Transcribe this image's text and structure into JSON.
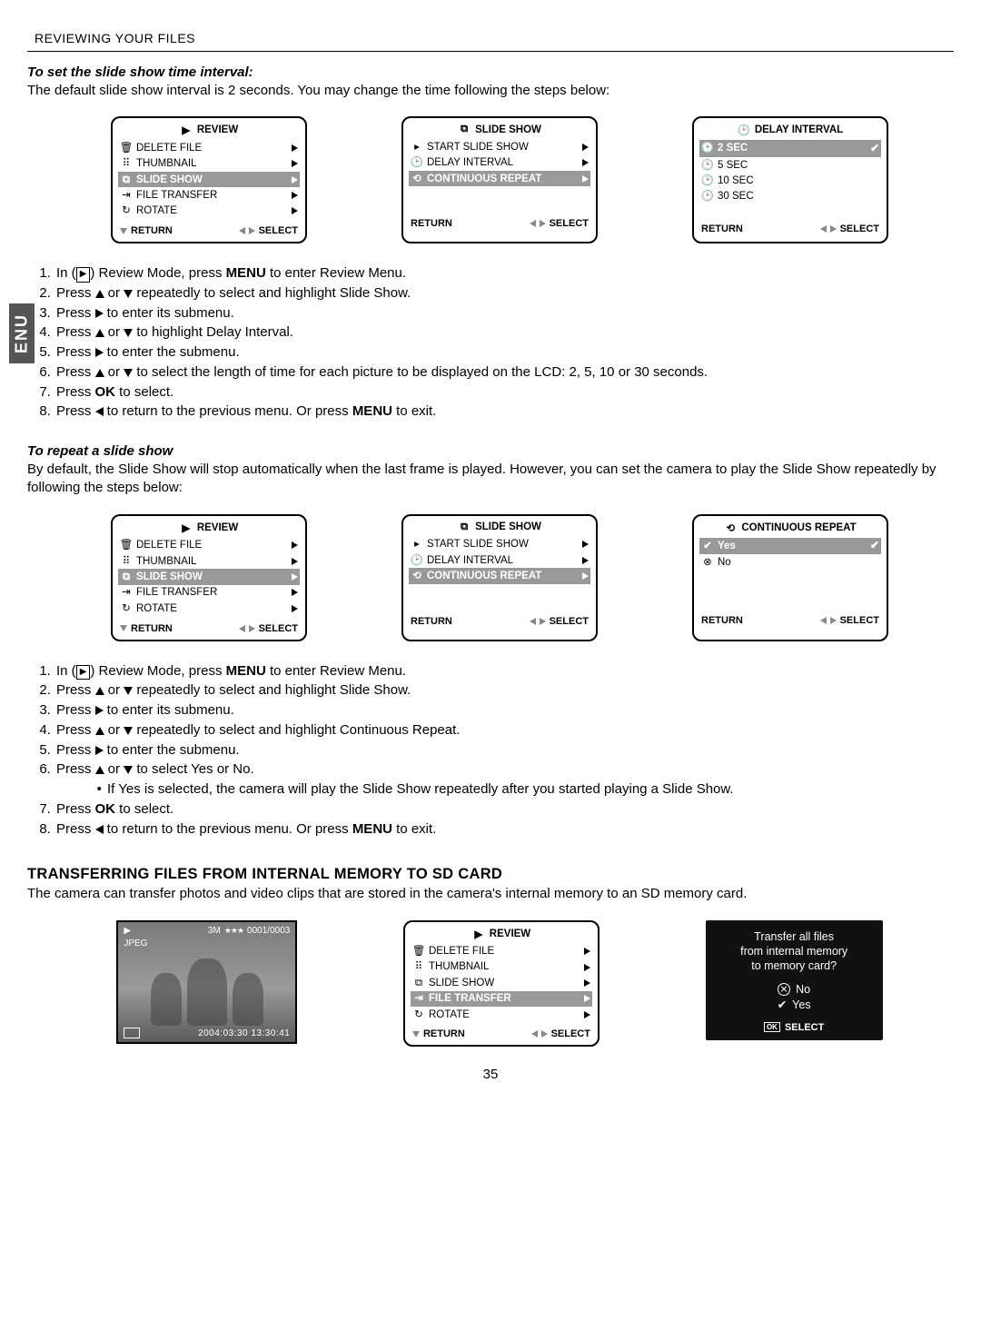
{
  "header": "REVIEWING YOUR FILES",
  "side_tab": "ENU",
  "page_number": "35",
  "sec1": {
    "subhead": "To set the slide show time interval:",
    "para": "The default slide show interval is 2 seconds. You may change the time following the steps below:",
    "menu1": {
      "title": "REVIEW",
      "items": [
        "DELETE FILE",
        "THUMBNAIL",
        "SLIDE SHOW",
        "FILE TRANSFER",
        "ROTATE"
      ],
      "hl_index": 2,
      "return": "RETURN",
      "select": "SELECT"
    },
    "menu2": {
      "title": "SLIDE SHOW",
      "items": [
        "START SLIDE SHOW",
        "DELAY INTERVAL",
        "CONTINUOUS REPEAT"
      ],
      "hl_index": 2,
      "return": "RETURN",
      "select": "SELECT"
    },
    "menu3": {
      "title": "DELAY INTERVAL",
      "items": [
        "2   SEC",
        "5   SEC",
        "10 SEC",
        "30 SEC"
      ],
      "hl_index": 0,
      "checked": true,
      "return": "RETURN",
      "select": "SELECT"
    },
    "steps_a": "In (",
    "steps_b": ") Review Mode, press ",
    "steps_menu": "MENU",
    "steps_c": " to enter Review Menu.",
    "s2a": "Press ",
    "s2b": " or ",
    "s2c": " repeatedly to select and highlight Slide Show.",
    "s3a": "Press ",
    "s3b": " to enter its submenu.",
    "s4a": "Press ",
    "s4b": " or ",
    "s4c": " to highlight Delay Interval.",
    "s5a": "Press ",
    "s5b": " to enter the submenu.",
    "s6a": "Press ",
    "s6b": " or ",
    "s6c": " to select the length of time for each picture to be displayed on the LCD: 2, 5, 10 or 30 seconds.",
    "s7a": "Press ",
    "s7ok": "OK",
    "s7b": " to select.",
    "s8a": "Press ",
    "s8b": " to return to the previous menu. Or press ",
    "s8menu": "MENU",
    "s8c": " to exit."
  },
  "sec2": {
    "subhead": "To repeat a slide show",
    "para": "By default, the Slide Show will stop automatically when the last frame is played. However, you can set the camera to play the Slide Show repeatedly by following the steps below:",
    "menu1": {
      "title": "REVIEW",
      "items": [
        "DELETE FILE",
        "THUMBNAIL",
        "SLIDE SHOW",
        "FILE TRANSFER",
        "ROTATE"
      ],
      "hl_index": 2,
      "return": "RETURN",
      "select": "SELECT"
    },
    "menu2": {
      "title": "SLIDE SHOW",
      "items": [
        "START SLIDE SHOW",
        "DELAY INTERVAL",
        "CONTINUOUS REPEAT"
      ],
      "hl_index": 2,
      "return": "RETURN",
      "select": "SELECT"
    },
    "menu3": {
      "title": "CONTINUOUS REPEAT",
      "items": [
        "Yes",
        "No"
      ],
      "hl_index": 0,
      "checked": true,
      "return": "RETURN",
      "select": "SELECT"
    },
    "s4c": " repeatedly to select and highlight Continuous Repeat.",
    "s6c": " to select Yes or No.",
    "sub1": "If Yes is selected, the camera will play the Slide Show repeatedly after you started playing a Slide Show."
  },
  "sec3": {
    "title": "TRANSFERRING FILES FROM INTERNAL MEMORY TO SD CARD",
    "para": "The camera can transfer photos and video clips that are stored in the camera's internal memory to an SD memory card.",
    "photo": {
      "jpeg": "JPEG",
      "res": "3M",
      "stars": "★★★",
      "counter": "0001/0003",
      "datetime": "2004:03:30   13:30:41"
    },
    "menu": {
      "title": "REVIEW",
      "items": [
        "DELETE FILE",
        "THUMBNAIL",
        "SLIDE SHOW",
        "FILE TRANSFER",
        "ROTATE"
      ],
      "hl_index": 3,
      "return": "RETURN",
      "select": "SELECT"
    },
    "dialog": {
      "l1": "Transfer all files",
      "l2": "from internal memory",
      "l3": "to memory card?",
      "no": "No",
      "yes": "Yes",
      "select": "SELECT",
      "ok": "OK"
    }
  }
}
